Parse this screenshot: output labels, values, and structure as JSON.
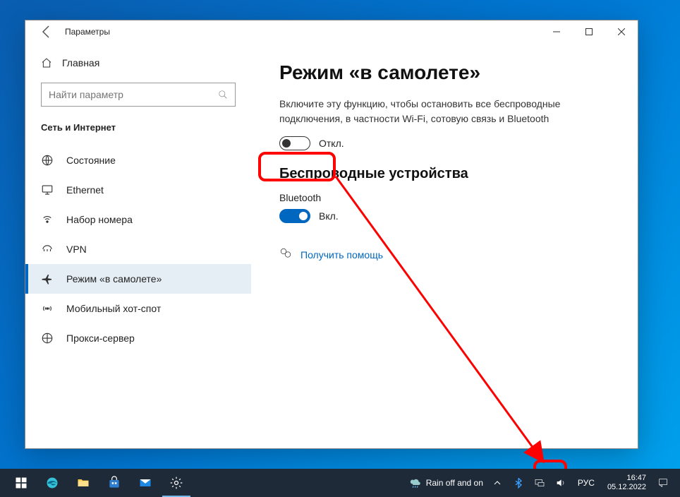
{
  "window": {
    "title": "Параметры",
    "home_label": "Главная",
    "search_placeholder": "Найти параметр",
    "section": "Сеть и Интернет"
  },
  "nav": {
    "items": [
      {
        "label": "Состояние"
      },
      {
        "label": "Ethernet"
      },
      {
        "label": "Набор номера"
      },
      {
        "label": "VPN"
      },
      {
        "label": "Режим «в самолете»"
      },
      {
        "label": "Мобильный хот-спот"
      },
      {
        "label": "Прокси-сервер"
      }
    ]
  },
  "content": {
    "title": "Режим «в самолете»",
    "description": "Включите эту функцию, чтобы остановить все беспроводные подключения, в частности Wi-Fi, сотовую связь и Bluetooth",
    "airplane_toggle_label": "Откл.",
    "wireless_heading": "Беспроводные устройства",
    "bluetooth_label": "Bluetooth",
    "bluetooth_toggle_label": "Вкл.",
    "help_link": "Получить помощь"
  },
  "taskbar": {
    "weather": "Rain off and on",
    "lang": "РУС",
    "time": "16:47",
    "date": "05.12.2022"
  }
}
